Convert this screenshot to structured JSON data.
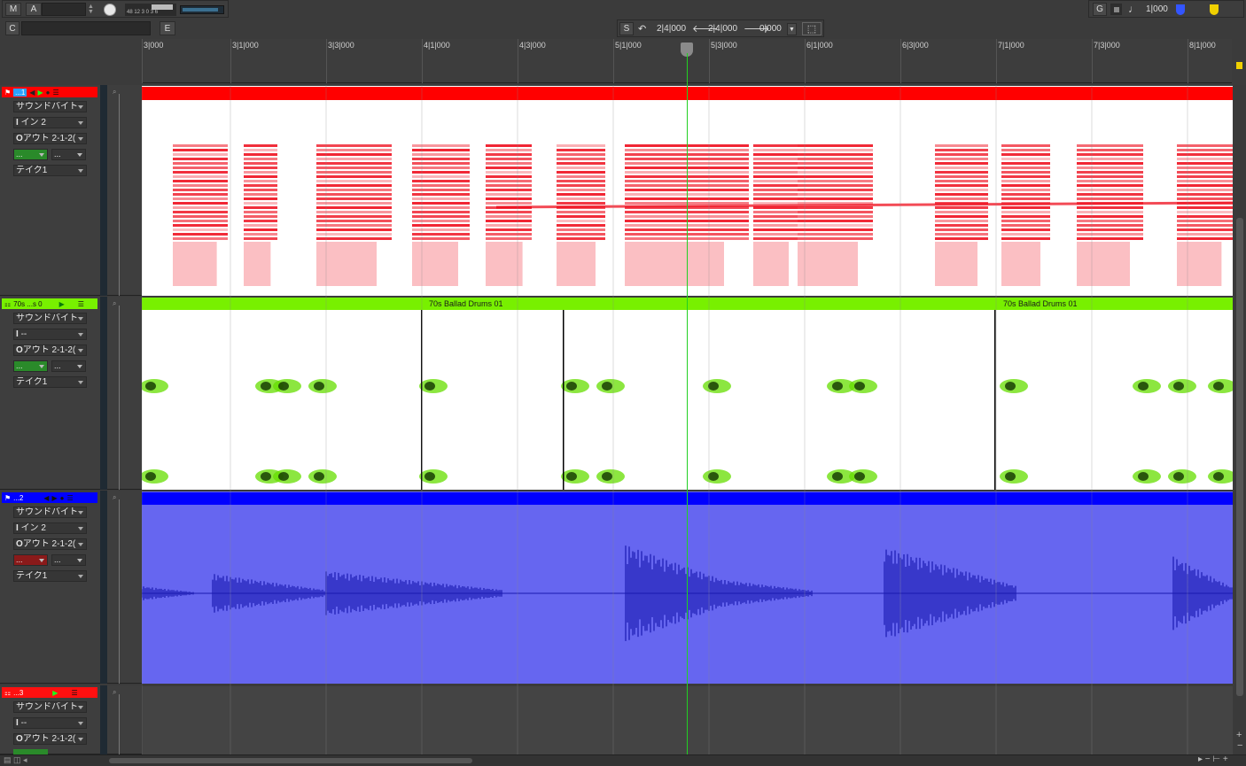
{
  "toolbar_top": {
    "m_label": "M",
    "a_label": "A",
    "meter_scale": "48 12 3 0 3 6",
    "c_label": "C",
    "e_label": "E",
    "g_label": "G",
    "quantize_value": "1|000"
  },
  "transport": {
    "s_label": "S",
    "pos_start": "2|4|000",
    "pos_end": "2|4|000",
    "length": "0|000"
  },
  "ruler": {
    "labels": [
      "3|000",
      "3|1|000",
      "3|3|000",
      "4|1|000",
      "4|3|000",
      "5|1|000",
      "5|3|000",
      "6|1|000",
      "6|3|000",
      "7|1|000",
      "7|3|000",
      "8|1|000"
    ]
  },
  "tracks": [
    {
      "name": "...1",
      "color": "#ff0000",
      "fields": {
        "type": "サウンドバイト",
        "input": "イン 2",
        "input_prefix": "I",
        "output": "アウト 2-1-2(",
        "output_prefix": "O",
        "mini_left": "...",
        "mini_right": "...",
        "take": "テイク1"
      }
    },
    {
      "name": "70s ...s 0",
      "color": "#78f000",
      "fields": {
        "type": "サウンドバイト",
        "input": "--",
        "input_prefix": "I",
        "output": "アウト 2-1-2(",
        "output_prefix": "O",
        "mini_left": "...",
        "mini_right": "...",
        "take": "テイク1"
      },
      "clips": [
        "70s Ballad Drums 01",
        "70s Ballad Drums 01"
      ]
    },
    {
      "name": "...2",
      "color": "#0000ff",
      "fields": {
        "type": "サウンドバイト",
        "input": "イン 2",
        "input_prefix": "I",
        "output": "アウト 2-1-2(",
        "output_prefix": "O",
        "mini_left": "...",
        "mini_right": "...",
        "take": "テイク1"
      }
    },
    {
      "name": "...3",
      "color": "#ff1010",
      "fields": {
        "type": "サウンドバイト",
        "input": "--",
        "input_prefix": "I",
        "output": "アウト 2-1-2(",
        "output_prefix": "O"
      }
    }
  ],
  "colors": {
    "playhead": "#22d022",
    "track1_spectrum": "#ee0010",
    "track2_spectrum": "#66dd00",
    "track3_bg": "#6666f0",
    "track3_wave": "#1a1ab0"
  }
}
